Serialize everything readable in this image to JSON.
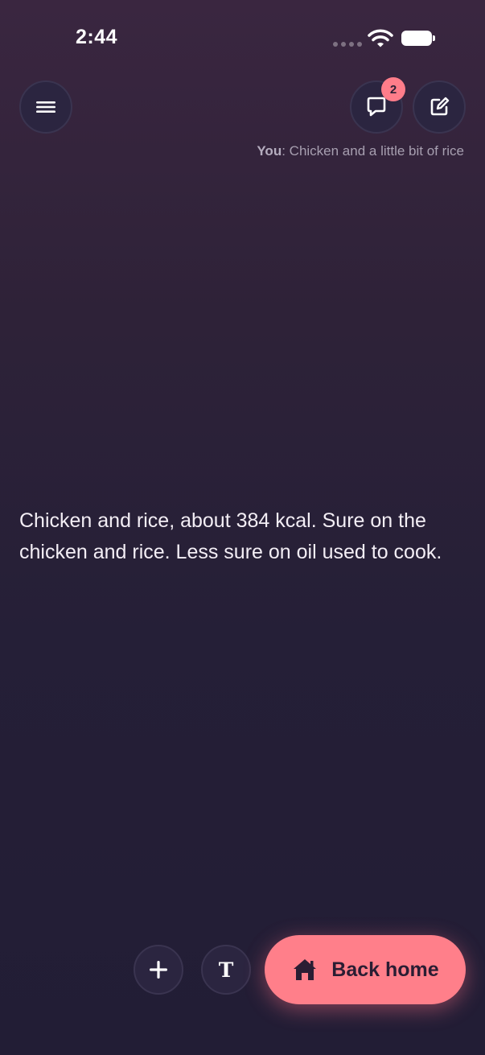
{
  "status_bar": {
    "time": "2:44"
  },
  "header": {
    "menu_icon": "hamburger-menu-icon",
    "chat_icon": "chat-bubble-icon",
    "chat_badge": "2",
    "edit_icon": "edit-square-icon",
    "last_message": {
      "sender": "You",
      "text": ": Chicken and a little bit of rice"
    }
  },
  "main": {
    "response_text": "Chicken and rice, about 384 kcal. Sure on the chicken and rice. Less sure on oil used to cook."
  },
  "bottom_bar": {
    "add_icon": "plus-icon",
    "text_mode_label": "T",
    "back_home_icon": "home-icon",
    "back_home_label": "Back home"
  },
  "colors": {
    "accent": "#ff7f8a",
    "background_top": "#3a2640",
    "background_bottom": "#221d35",
    "button_bg": "#2b2540"
  }
}
